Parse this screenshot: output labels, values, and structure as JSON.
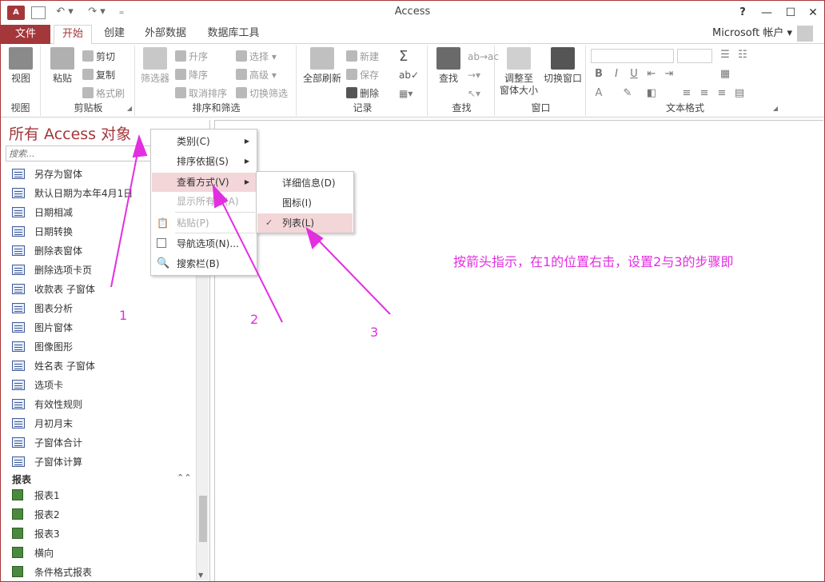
{
  "titlebar": {
    "app_icon": "A",
    "title": "Access",
    "help": "?",
    "undo": "↶ ▾",
    "redo": "↷ ▾",
    "qat_more": "₌"
  },
  "tabs": {
    "file": "文件",
    "home": "开始",
    "create": "创建",
    "external": "外部数据",
    "dbtools": "数据库工具",
    "account": "Microsoft 帐户 ▾"
  },
  "ribbon": {
    "view": {
      "button": "视图",
      "group": "视图"
    },
    "clipboard": {
      "paste": "粘贴",
      "cut": "剪切",
      "copy": "复制",
      "format_painter": "格式刷",
      "group": "剪贴板"
    },
    "sort_filter": {
      "filter": "筛选器",
      "ascending": "升序",
      "descending": "降序",
      "remove_sort": "取消排序",
      "select": "选择 ▾",
      "advanced": "高级 ▾",
      "toggle_filter": "切换筛选",
      "group": "排序和筛选"
    },
    "records": {
      "refresh_all": "全部刷新",
      "new": "新建",
      "save": "保存",
      "delete": "删除",
      "group": "记录"
    },
    "find": {
      "find": "查找",
      "group": "查找"
    },
    "window": {
      "fit_form": "调整至\n窗体大小",
      "switch_windows": "切换窗口",
      "group": "窗口"
    },
    "text_format": {
      "bold": "B",
      "italic": "I",
      "underline": "U",
      "font_color": "A",
      "group": "文本格式"
    }
  },
  "nav": {
    "header": "所有 Access 对象",
    "search_placeholder": "搜索...",
    "forms": [
      "另存为窗体",
      "默认日期为本年4月1日",
      "日期相减",
      "日期转换",
      "删除表窗体",
      "删除选项卡页",
      "收款表 子窗体",
      "图表分析",
      "图片窗体",
      "图像图形",
      "姓名表 子窗体",
      "选项卡",
      "有效性规则",
      "月初月末",
      "子窗体合计",
      "子窗体计算"
    ],
    "reports_section": "报表",
    "reports": [
      "报表1",
      "报表2",
      "报表3",
      "横向",
      "条件格式报表"
    ]
  },
  "context_menu": {
    "category": "类别(C)",
    "sort_by": "排序依据(S)",
    "view_by": "查看方式(V)",
    "show_all": "显示所有组(A)",
    "paste": "粘贴(P)",
    "nav_options": "导航选项(N)...",
    "search_bar": "搜索栏(B)"
  },
  "submenu": {
    "details": "详细信息(D)",
    "icons": "图标(I)",
    "list": "列表(L)"
  },
  "annotations": {
    "instruction": "按箭头指示，在1的位置右击，设置2与3的步骤即",
    "n1": "1",
    "n2": "2",
    "n3": "3",
    "color": "#e22fe0"
  },
  "colors": {
    "accent": "#a4373a",
    "highlight": "#f3d6d8"
  }
}
